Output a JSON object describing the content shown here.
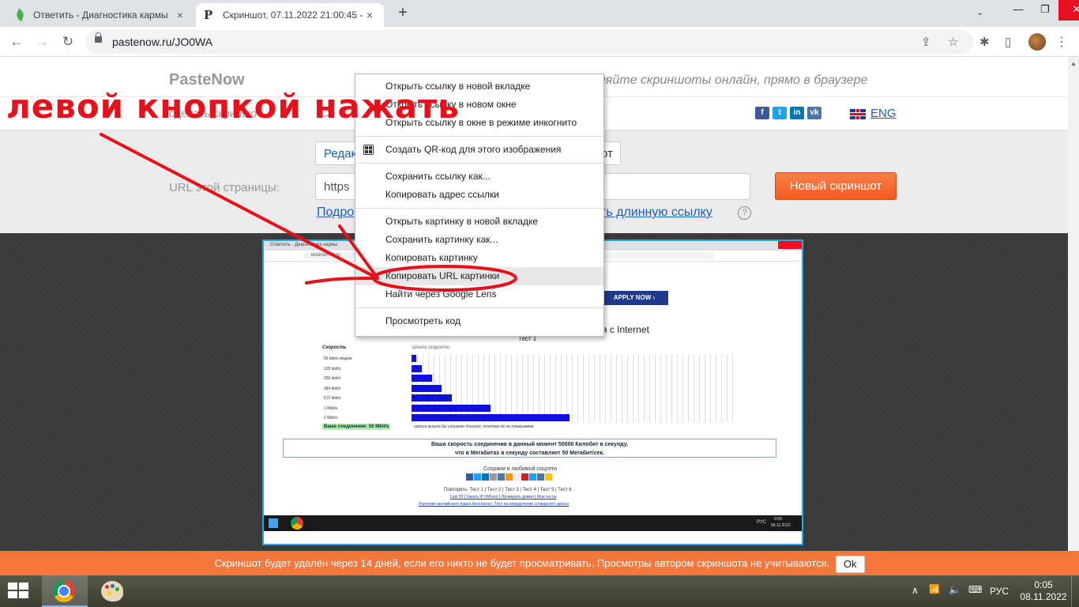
{
  "tabs": [
    {
      "title": "Ответить - Диагностика кармы",
      "close": "×"
    },
    {
      "title": "Скриншот, 07.11.2022 21:00:45 -",
      "close": "×"
    }
  ],
  "tabstrip": {
    "new_tab": "+",
    "tab_search": "⌄",
    "minimize": "—",
    "maximize": "❐",
    "close": "✕"
  },
  "toolbar": {
    "back": "←",
    "forward": "→",
    "reload": "↻",
    "url": "pastenow.ru/JO0WA",
    "share": "⇪",
    "bookmark": "☆",
    "extensions": "✱",
    "sidebar": "▯",
    "menu": "⋮"
  },
  "site": {
    "logo": "PasteNow",
    "tagline": "няйте скриншоты онлайн, прямо в браузере",
    "nav_left": "сделать скриншот",
    "nav_right": "С",
    "social": [
      {
        "label": "f",
        "color": "#3b5998"
      },
      {
        "label": "t",
        "color": "#1da1f2"
      },
      {
        "label": "in",
        "color": "#0077b5"
      },
      {
        "label": "vk",
        "color": "#4a76a8"
      }
    ],
    "lang": "ENG",
    "edit_btn": "Редак",
    "right_btn": "от",
    "url_label": "URL этой страницы:",
    "url_value": "https",
    "new_screenshot_btn": "Новый скриншот",
    "link_left": "Подро",
    "link_right": "ть длинную ссылку",
    "help": "?"
  },
  "context_menu": {
    "groups": [
      [
        "Открыть ссылку в новой вкладке",
        "Открыть ссылку в новом окне",
        "Открыть ссылку в окне в режиме инкогнито"
      ],
      [
        "Создать QR-код для этого изображения"
      ],
      [
        "Сохранить ссылку как...",
        "Копировать адрес ссылки"
      ],
      [
        "Открыть картинку в новой вкладке",
        "Сохранить картинку как...",
        "Копировать картинку",
        "Копировать URL картинки",
        "Найти через Google Lens"
      ],
      [
        "Просмотреть код"
      ]
    ],
    "highlighted": "Копировать URL картинки"
  },
  "annotation": {
    "text": "левой кнопкой нажать",
    "color": "#e8101a"
  },
  "thumbnail": {
    "tab_text": "Ответить - Диагностика кармы",
    "address": "testinternet.ru",
    "apply": "APPLY NOW  ›",
    "title": "я с Internet",
    "subtitle": "Тест 1",
    "speed_heading": "Скорость",
    "scale_heading": "Шкала скорости",
    "rows": [
      {
        "label": "56 kbit/s модем",
        "value": 0.056
      },
      {
        "label": "128 kbit/s",
        "value": 0.128
      },
      {
        "label": "256 kbit/s",
        "value": 0.256
      },
      {
        "label": "384 kbit/s",
        "value": 0.384
      },
      {
        "label": "512 kbit/s",
        "value": 0.512
      },
      {
        "label": "1 Mbit/s",
        "value": 1
      },
      {
        "label": "2 Mbit/s",
        "value": 2
      }
    ],
    "connection": "Ваше соединение: 50 Mbit/s",
    "note": "полоса вышла бы слишком длинной, поэтому её не показываем",
    "result_line1": "Ваша скорость соединения в данный момент 50000 Килобит в секунду,",
    "result_line2": "что в Мегабитах в секунду составляет 50 Мегабит/сек.",
    "save_social": "Сохрани в любимой соцсети",
    "tests": "Повторить: Тест 1 | Тест 2 | Тест 3 | Тест 4 | Тест 5 | Тест 6",
    "links": "Last 20 | Узнать IP (Whois) | Проверить домен | Мои тесты",
    "links2": "Изучение английского языка бесплатно | Тест на определение словарного запаса",
    "tray_lang": "РУС",
    "tray_time": "0:09",
    "tray_date": "08.11.2022"
  },
  "notice": {
    "text": "Скриншот будет удалён через 14 дней, если его никто не будет просматривать. Просмотры автором скриншота не учитываются.",
    "ok": "Ok"
  },
  "taskbar": {
    "tray_arrow": "∧",
    "network": "📶",
    "volume": "🔈",
    "ime": "⌨",
    "lang": "РУС",
    "time": "0:05",
    "date": "08.11.2022"
  }
}
